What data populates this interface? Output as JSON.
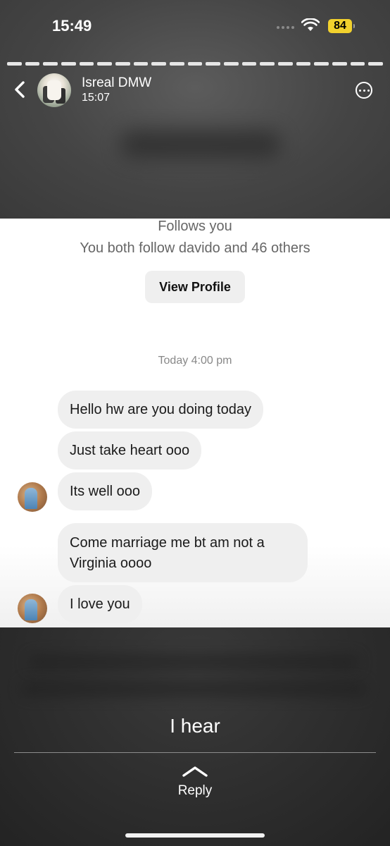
{
  "status_bar": {
    "time": "15:49",
    "battery": "84"
  },
  "header": {
    "user_name": "Isreal DMW",
    "post_time": "15:07"
  },
  "profile_card": {
    "follows_text": "Follows you",
    "mutual_text": "You both follow davido and 46 others",
    "view_profile_label": "View Profile"
  },
  "chat": {
    "date_separator": "Today 4:00 pm",
    "messages": [
      "Hello hw are you doing today",
      "Just take heart ooo",
      "Its well ooo",
      "Come marriage me bt am not a Virginia oooo",
      "I love you"
    ]
  },
  "story": {
    "caption": "I hear",
    "reply_label": "Reply"
  },
  "colors": {
    "battery": "#f2d12d",
    "bubble": "#efefef"
  },
  "icons": [
    "back-icon",
    "more-options-icon",
    "wifi-icon",
    "chevron-up-icon"
  ]
}
